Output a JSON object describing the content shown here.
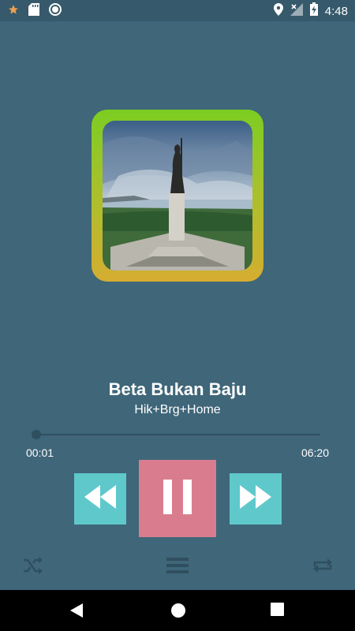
{
  "status_bar": {
    "time": "4:48",
    "icons": [
      "star-icon",
      "sd-card-icon",
      "record-icon",
      "location-icon",
      "no-signal-icon",
      "battery-charging-icon"
    ]
  },
  "player": {
    "title": "Beta Bukan Baju",
    "artist": "Hik+Brg+Home",
    "current_time": "00:01",
    "total_time": "06:20",
    "progress_fraction": 0.003
  },
  "controls": {
    "rewind": "rewind-icon",
    "play_pause": "pause-icon",
    "fast_forward": "fast-forward-icon",
    "shuffle": "shuffle-icon",
    "playlist": "menu-icon",
    "repeat": "repeat-icon"
  },
  "colors": {
    "background": "#3f6679",
    "side_button": "#5fc8cb",
    "play_button": "#d97d8e",
    "art_border_top": "#7ccd22",
    "art_border_bottom": "#d6ad30"
  }
}
